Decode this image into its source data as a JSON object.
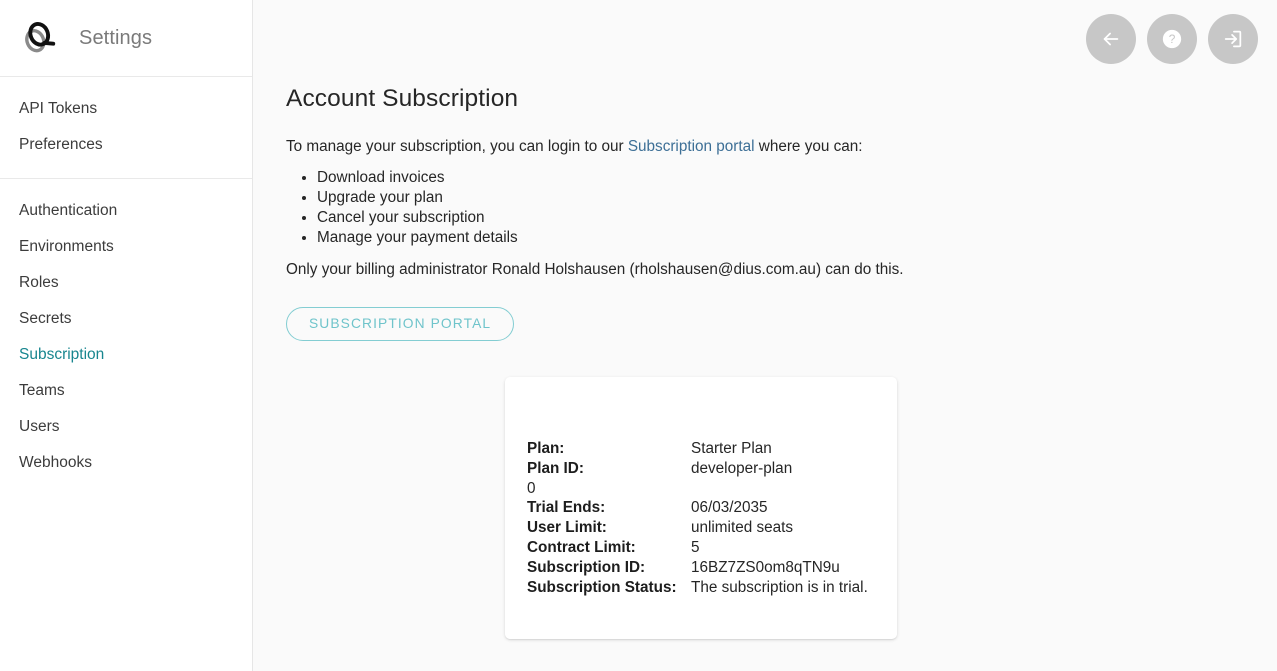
{
  "sidebar": {
    "logo_icon": "pact-swirl-logo-icon",
    "title": "Settings",
    "groups": [
      {
        "items": [
          {
            "label": "API Tokens",
            "active": false
          },
          {
            "label": "Preferences",
            "active": false
          }
        ]
      },
      {
        "items": [
          {
            "label": "Authentication",
            "active": false
          },
          {
            "label": "Environments",
            "active": false
          },
          {
            "label": "Roles",
            "active": false
          },
          {
            "label": "Secrets",
            "active": false
          },
          {
            "label": "Subscription",
            "active": true
          },
          {
            "label": "Teams",
            "active": false
          },
          {
            "label": "Users",
            "active": false
          },
          {
            "label": "Webhooks",
            "active": false
          }
        ]
      }
    ],
    "active_color": "#18868f"
  },
  "topbar": {
    "buttons": [
      {
        "name": "back-button",
        "icon": "arrow-left-icon"
      },
      {
        "name": "help-button",
        "icon": "question-mark-circle-icon"
      },
      {
        "name": "exit-button",
        "icon": "logout-arrow-into-box-icon"
      }
    ],
    "button_color": "#c7c7c7"
  },
  "main": {
    "title": "Account Subscription",
    "intro_before": "To manage your subscription, you can login to our ",
    "intro_link": "Subscription portal",
    "intro_after": " where you can:",
    "link_color": "#3d6f96",
    "benefits": [
      "Download invoices",
      "Upgrade your plan",
      "Cancel your subscription",
      "Manage your payment details"
    ],
    "billing_note": "Only your billing administrator Ronald Holshausen (rholshausen@dius.com.au) can do this.",
    "portal_button_label": "Subscription portal",
    "portal_button_color": "#6fc4cb"
  },
  "card": {
    "rows": [
      {
        "label": "Plan:",
        "value": "Starter Plan"
      },
      {
        "label": "Plan ID:",
        "value": "developer-plan"
      }
    ],
    "orphan_value": "0",
    "rows2": [
      {
        "label": "Trial Ends:",
        "value": "06/03/2035"
      },
      {
        "label": "User Limit:",
        "value": "unlimited seats"
      },
      {
        "label": "Contract Limit:",
        "value": "5"
      },
      {
        "label": "Subscription ID:",
        "value": "16BZ7ZS0om8qTN9u"
      },
      {
        "label": "Subscription Status:",
        "value": "The subscription is in trial."
      }
    ]
  }
}
